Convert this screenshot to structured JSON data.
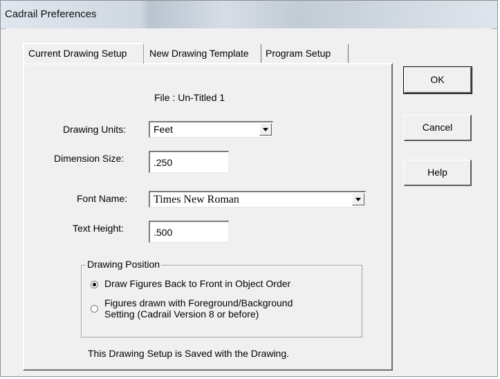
{
  "window": {
    "title": "Cadrail Preferences"
  },
  "tabs": [
    {
      "label": "Current Drawing Setup",
      "active": true
    },
    {
      "label": "New Drawing Template",
      "active": false
    },
    {
      "label": "Program Setup",
      "active": false
    }
  ],
  "setup": {
    "file_label": "File : Un-Titled 1",
    "drawing_units": {
      "label": "Drawing Units:",
      "value": "Feet"
    },
    "dimension_size": {
      "label": "Dimension Size:",
      "value": ".250"
    },
    "font_name": {
      "label": "Font Name:",
      "value": "Times New Roman"
    },
    "text_height": {
      "label": "Text Height:",
      "value": ".500"
    },
    "drawing_position": {
      "legend": "Drawing Position",
      "options": [
        {
          "line1": "Draw Figures Back to Front in Object Order",
          "line2": "",
          "selected": true
        },
        {
          "line1": "Figures drawn with Foreground/Background",
          "line2": "Setting (Cadrail Version 8 or before)",
          "selected": false
        }
      ]
    },
    "note": "This Drawing Setup is Saved with the Drawing."
  },
  "buttons": {
    "ok": "OK",
    "cancel": "Cancel",
    "help": "Help"
  }
}
